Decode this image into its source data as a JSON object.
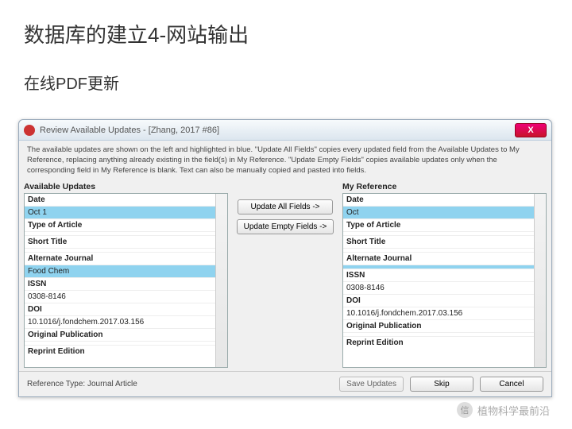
{
  "page": {
    "title": "数据库的建立4-网站输出",
    "subtitle": "在线PDF更新"
  },
  "dialog": {
    "title": "Review Available Updates - [Zhang, 2017 #86]",
    "close": "X",
    "instructions": "The available updates are shown on the left and highlighted in blue. \"Update All Fields\" copies every updated field from the Available Updates to My Reference, replacing anything already existing in the field(s) in My Reference. \"Update Empty Fields\" copies available updates only when the corresponding field in My Reference is blank. Text can also be manually copied and pasted into fields.",
    "left_header": "Available Updates",
    "right_header": "My Reference",
    "btn_all": "Update All Fields ->",
    "btn_empty": "Update Empty Fields ->",
    "reftype": "Reference Type: Journal Article",
    "save": "Save Updates",
    "skip": "Skip",
    "cancel": "Cancel"
  },
  "left": {
    "date_label": "Date",
    "date_value": "Oct 1",
    "type_label": "Type of Article",
    "short_title": "Short Title",
    "alt_journal": "Alternate Journal",
    "alt_journal_value": "Food Chem",
    "issn": "ISSN",
    "issn_value": "0308-8146",
    "doi": "DOI",
    "doi_value": "10.1016/j.fondchem.2017.03.156",
    "orig_pub": "Original Publication",
    "reprint": "Reprint Edition"
  },
  "right": {
    "date_label": "Date",
    "date_value": "Oct",
    "type_label": "Type of Article",
    "short_title": "Short Title",
    "alt_journal": "Alternate Journal",
    "issn": "ISSN",
    "issn_value": "0308-8146",
    "doi": "DOI",
    "doi_value": "10.1016/j.fondchem.2017.03.156",
    "orig_pub": "Original Publication",
    "reprint": "Reprint Edition"
  },
  "watermark": {
    "text": "植物科学最前沿",
    "icon": "信"
  }
}
